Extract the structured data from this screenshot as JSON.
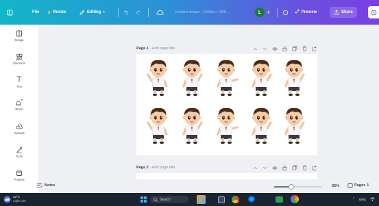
{
  "topbar": {
    "file_label": "File",
    "resize_label": "Resize",
    "editing_label": "Editing",
    "doc_title": "Untitled design - 1600px × 800...",
    "avatar_letter": "L",
    "preview_label": "Preview",
    "share_label": "Share"
  },
  "sidebar": {
    "items": [
      {
        "label": "Design",
        "icon": "design-icon"
      },
      {
        "label": "Elements",
        "icon": "elements-icon"
      },
      {
        "label": "Text",
        "icon": "text-icon"
      },
      {
        "label": "Brand",
        "icon": "brand-icon"
      },
      {
        "label": "Uploads",
        "icon": "uploads-icon"
      },
      {
        "label": "Tools",
        "icon": "tools-icon"
      },
      {
        "label": "Projects",
        "icon": "projects-icon"
      }
    ]
  },
  "pages": [
    {
      "number": "Page 1",
      "title_placeholder": "- Add page title"
    },
    {
      "number": "Page 2",
      "title_placeholder": "- Add page title"
    }
  ],
  "footer": {
    "notes_label": "Notes",
    "zoom_value": "35%",
    "zoom_fraction": 0.35,
    "pages_label": "Pages",
    "pages_count": "1"
  },
  "taskbar": {
    "weather_temp": "23°C",
    "weather_desc": "Light rain",
    "search_label": "Search",
    "lang": "ENG"
  },
  "colors": {
    "topbar_start": "#12b6c9",
    "topbar_end": "#7b3fe4",
    "avatar": "#1f7a3a",
    "taskbar": "#1b2330"
  }
}
